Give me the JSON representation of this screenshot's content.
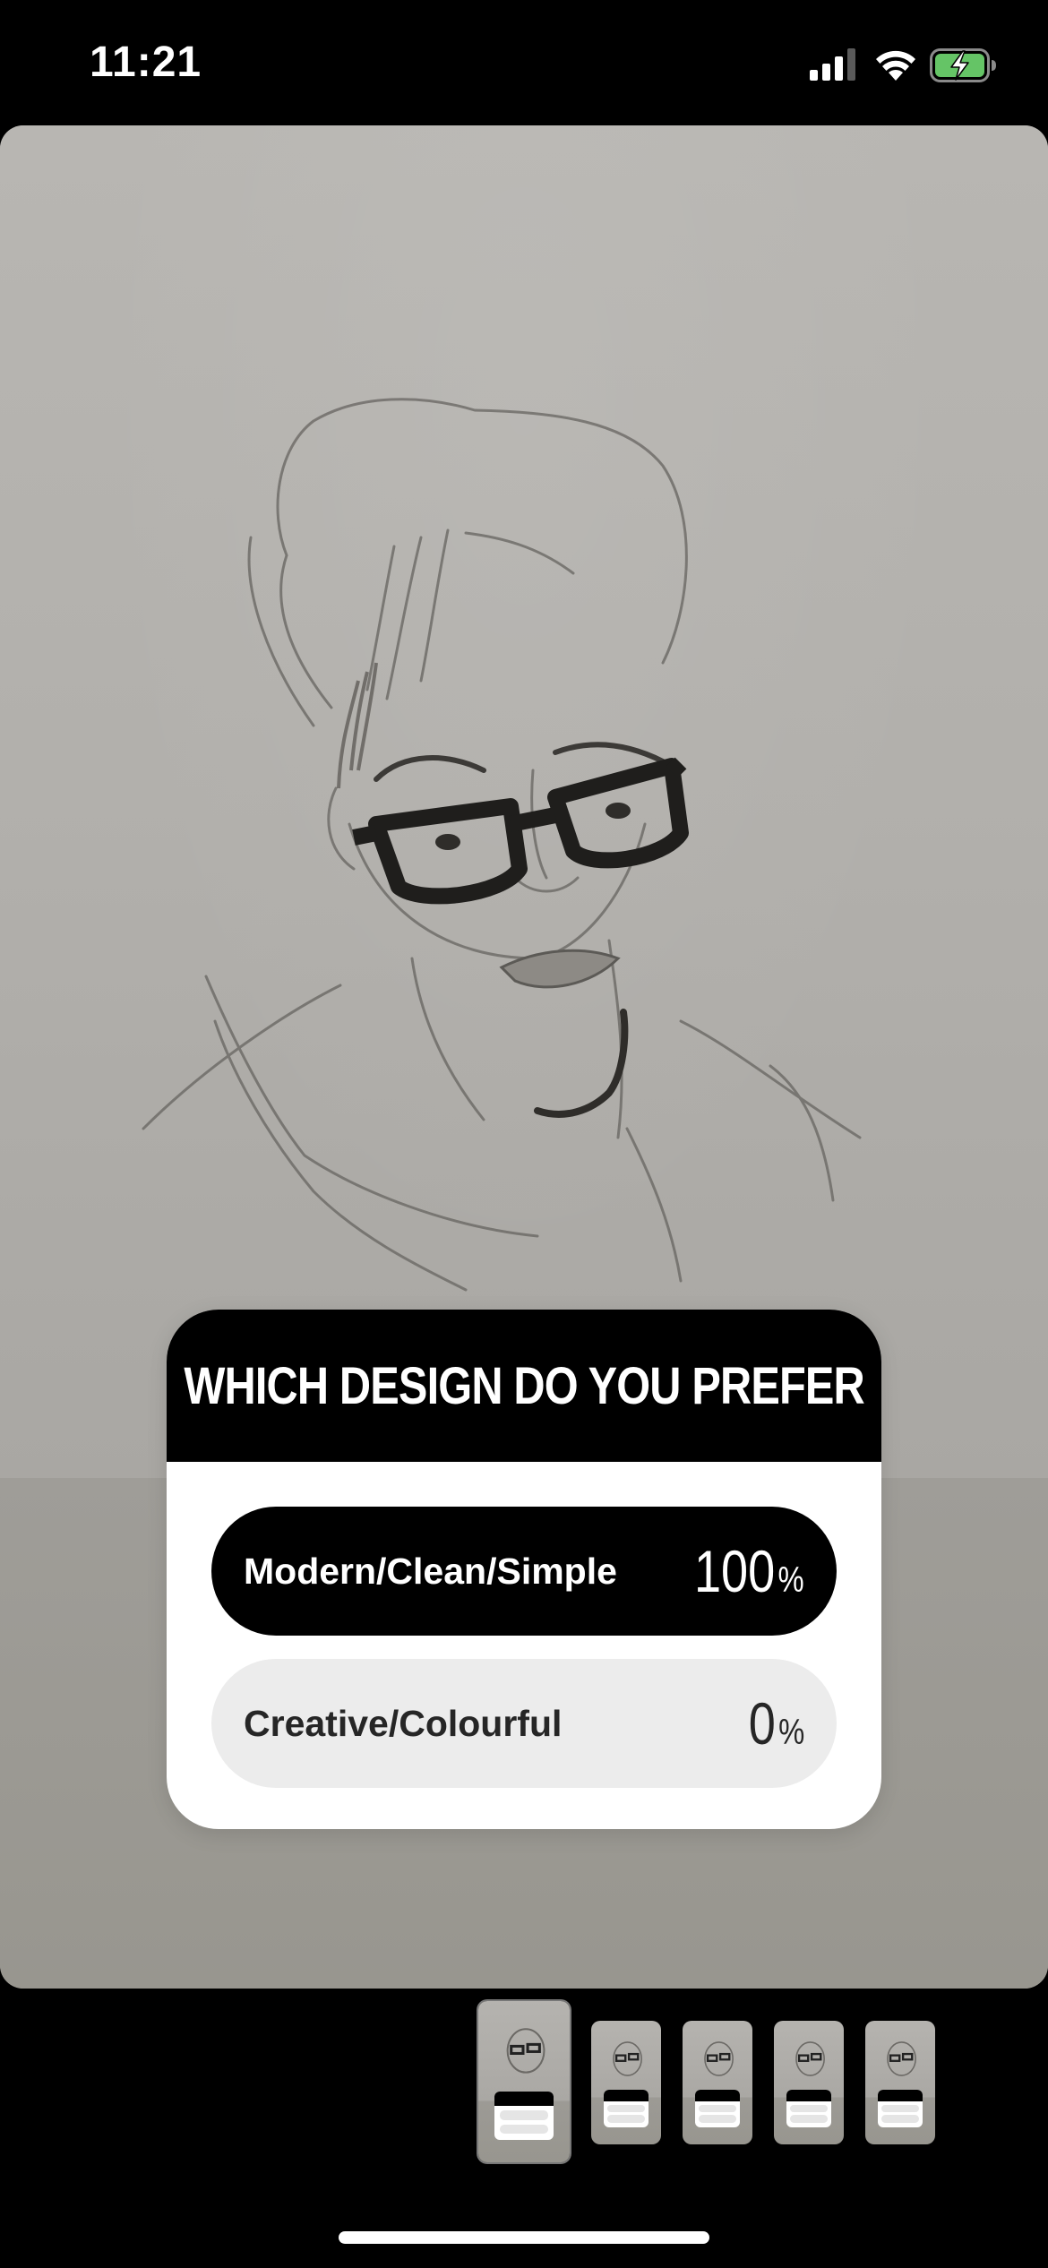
{
  "status_bar": {
    "time": "11:21",
    "icons": [
      "signal-icon",
      "wifi-icon",
      "battery-charging-icon"
    ],
    "battery_color": "#65c466"
  },
  "story": {
    "image_subject": "pencil-sketch-portrait"
  },
  "poll": {
    "question": "WHICH DESIGN DO YOU PREFER",
    "options": [
      {
        "label": "Modern/Clean/Simple",
        "percent_value": "100",
        "percent_sign": "%",
        "selected": true
      },
      {
        "label": "Creative/Colourful",
        "percent_value": "0",
        "percent_sign": "%",
        "selected": false
      }
    ],
    "colors": {
      "header_bg": "#000000",
      "selected_bg": "#000000",
      "unselected_bg": "#ececec"
    }
  },
  "thumbnails": {
    "count": 5,
    "active_index": 0
  }
}
